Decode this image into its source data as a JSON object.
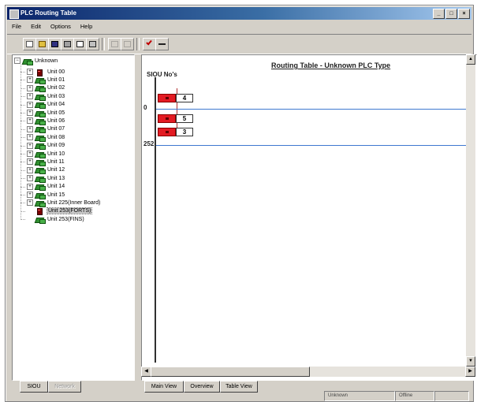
{
  "window": {
    "title": "PLC Routing Table",
    "controls": [
      "_",
      "□",
      "×"
    ]
  },
  "menu": [
    "File",
    "Edit",
    "Options",
    "Help"
  ],
  "toolbar": {
    "buttons": [
      {
        "icon": "new-icon",
        "enabled": true
      },
      {
        "icon": "open-icon",
        "enabled": true
      },
      {
        "icon": "save-icon",
        "enabled": true
      },
      {
        "icon": "print-icon",
        "enabled": true
      },
      {
        "icon": "print-preview-icon",
        "enabled": true
      },
      {
        "icon": "export-icon",
        "enabled": true
      },
      {
        "icon": "cut-icon",
        "enabled": false
      },
      {
        "icon": "copy-icon",
        "enabled": false
      },
      {
        "icon": "check-icon",
        "enabled": true
      },
      {
        "icon": "minus-icon",
        "enabled": true
      }
    ]
  },
  "tree": {
    "root": "Unknown",
    "units": [
      {
        "label": "Unit 00",
        "icon": "pc",
        "expander": "+"
      },
      {
        "label": "Unit 01",
        "icon": "green",
        "expander": "+"
      },
      {
        "label": "Unit 02",
        "icon": "green",
        "expander": "+"
      },
      {
        "label": "Unit 03",
        "icon": "green",
        "expander": "+"
      },
      {
        "label": "Unit 04",
        "icon": "green",
        "expander": "+"
      },
      {
        "label": "Unit 05",
        "icon": "green",
        "expander": "+"
      },
      {
        "label": "Unit 06",
        "icon": "green",
        "expander": "+"
      },
      {
        "label": "Unit 07",
        "icon": "green",
        "expander": "+"
      },
      {
        "label": "Unit 08",
        "icon": "green",
        "expander": "+"
      },
      {
        "label": "Unit 09",
        "icon": "green",
        "expander": "+"
      },
      {
        "label": "Unit 10",
        "icon": "green",
        "expander": "+"
      },
      {
        "label": "Unit 11",
        "icon": "green",
        "expander": "+"
      },
      {
        "label": "Unit 12",
        "icon": "green",
        "expander": "+"
      },
      {
        "label": "Unit 13",
        "icon": "green",
        "expander": "+"
      },
      {
        "label": "Unit 14",
        "icon": "green",
        "expander": "+"
      },
      {
        "label": "Unit 15",
        "icon": "green",
        "expander": "+"
      },
      {
        "label": "Unit 225(Inner Board)",
        "icon": "green",
        "expander": "+"
      },
      {
        "label": "Unit 253(FORTS)",
        "icon": "pc",
        "expander": "",
        "selected": true
      },
      {
        "label": "Unit 253(FINS)",
        "icon": "green",
        "expander": ""
      }
    ]
  },
  "left_buttons": {
    "sioui": "SIOU",
    "network": "Network"
  },
  "view": {
    "title": "Routing Table - Unknown PLC Type",
    "sidu_label": "SIOU No's",
    "row_labels": [
      "0",
      "252"
    ],
    "routes": [
      "4",
      "5",
      "3"
    ]
  },
  "view_tabs": [
    "Main View",
    "Overview",
    "Table View"
  ],
  "status": {
    "type": "Unknown",
    "mode": "Offline"
  }
}
